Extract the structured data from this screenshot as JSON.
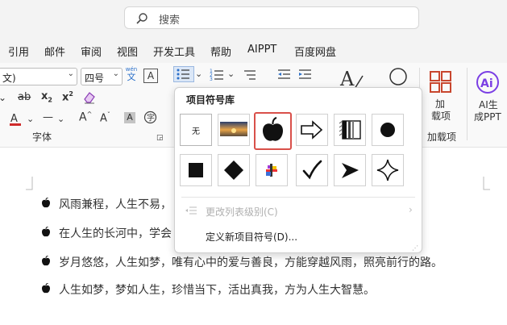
{
  "search": {
    "placeholder": "搜索"
  },
  "menu": {
    "items": [
      "引用",
      "邮件",
      "审阅",
      "视图",
      "开发工具",
      "帮助",
      "AIPPT",
      "百度网盘"
    ]
  },
  "ribbon": {
    "font_name_value": "文)",
    "font_size_value": "四号",
    "wen_label": "wén",
    "wen_char": "文",
    "a_boxed": "A",
    "abc_strike": "ab",
    "subscript_x": "x",
    "subscript_2": "2",
    "superscript_x": "x",
    "superscript_2": "2",
    "font_group_label": "字体",
    "addins_big_label_1": "加",
    "addins_big_label_2": "载项",
    "addins_group_label": "加载项",
    "ai_label_1": "AI生",
    "ai_label_2": "成PPT",
    "ai_icon_text": "Ai"
  },
  "bullet_library": {
    "title": "项目符号库",
    "none_label": "无",
    "change_level": "更改列表级别(C)",
    "define_new": "定义新项目符号(D)..."
  },
  "document": {
    "lines": [
      "风雨兼程，人生不易，",
      "在人生的长河中，学会",
      "岁月悠悠，人生如梦，唯有心中的爱与善良，方能穿越风雨，照亮前行的路。",
      "人生如梦，梦如人生，珍惜当下，活出真我，方为人生大智慧。"
    ]
  },
  "colors": {
    "selected_border": "#d9504a",
    "accent_orange": "#c8462e",
    "ai_purple": "#7b3fe4"
  }
}
